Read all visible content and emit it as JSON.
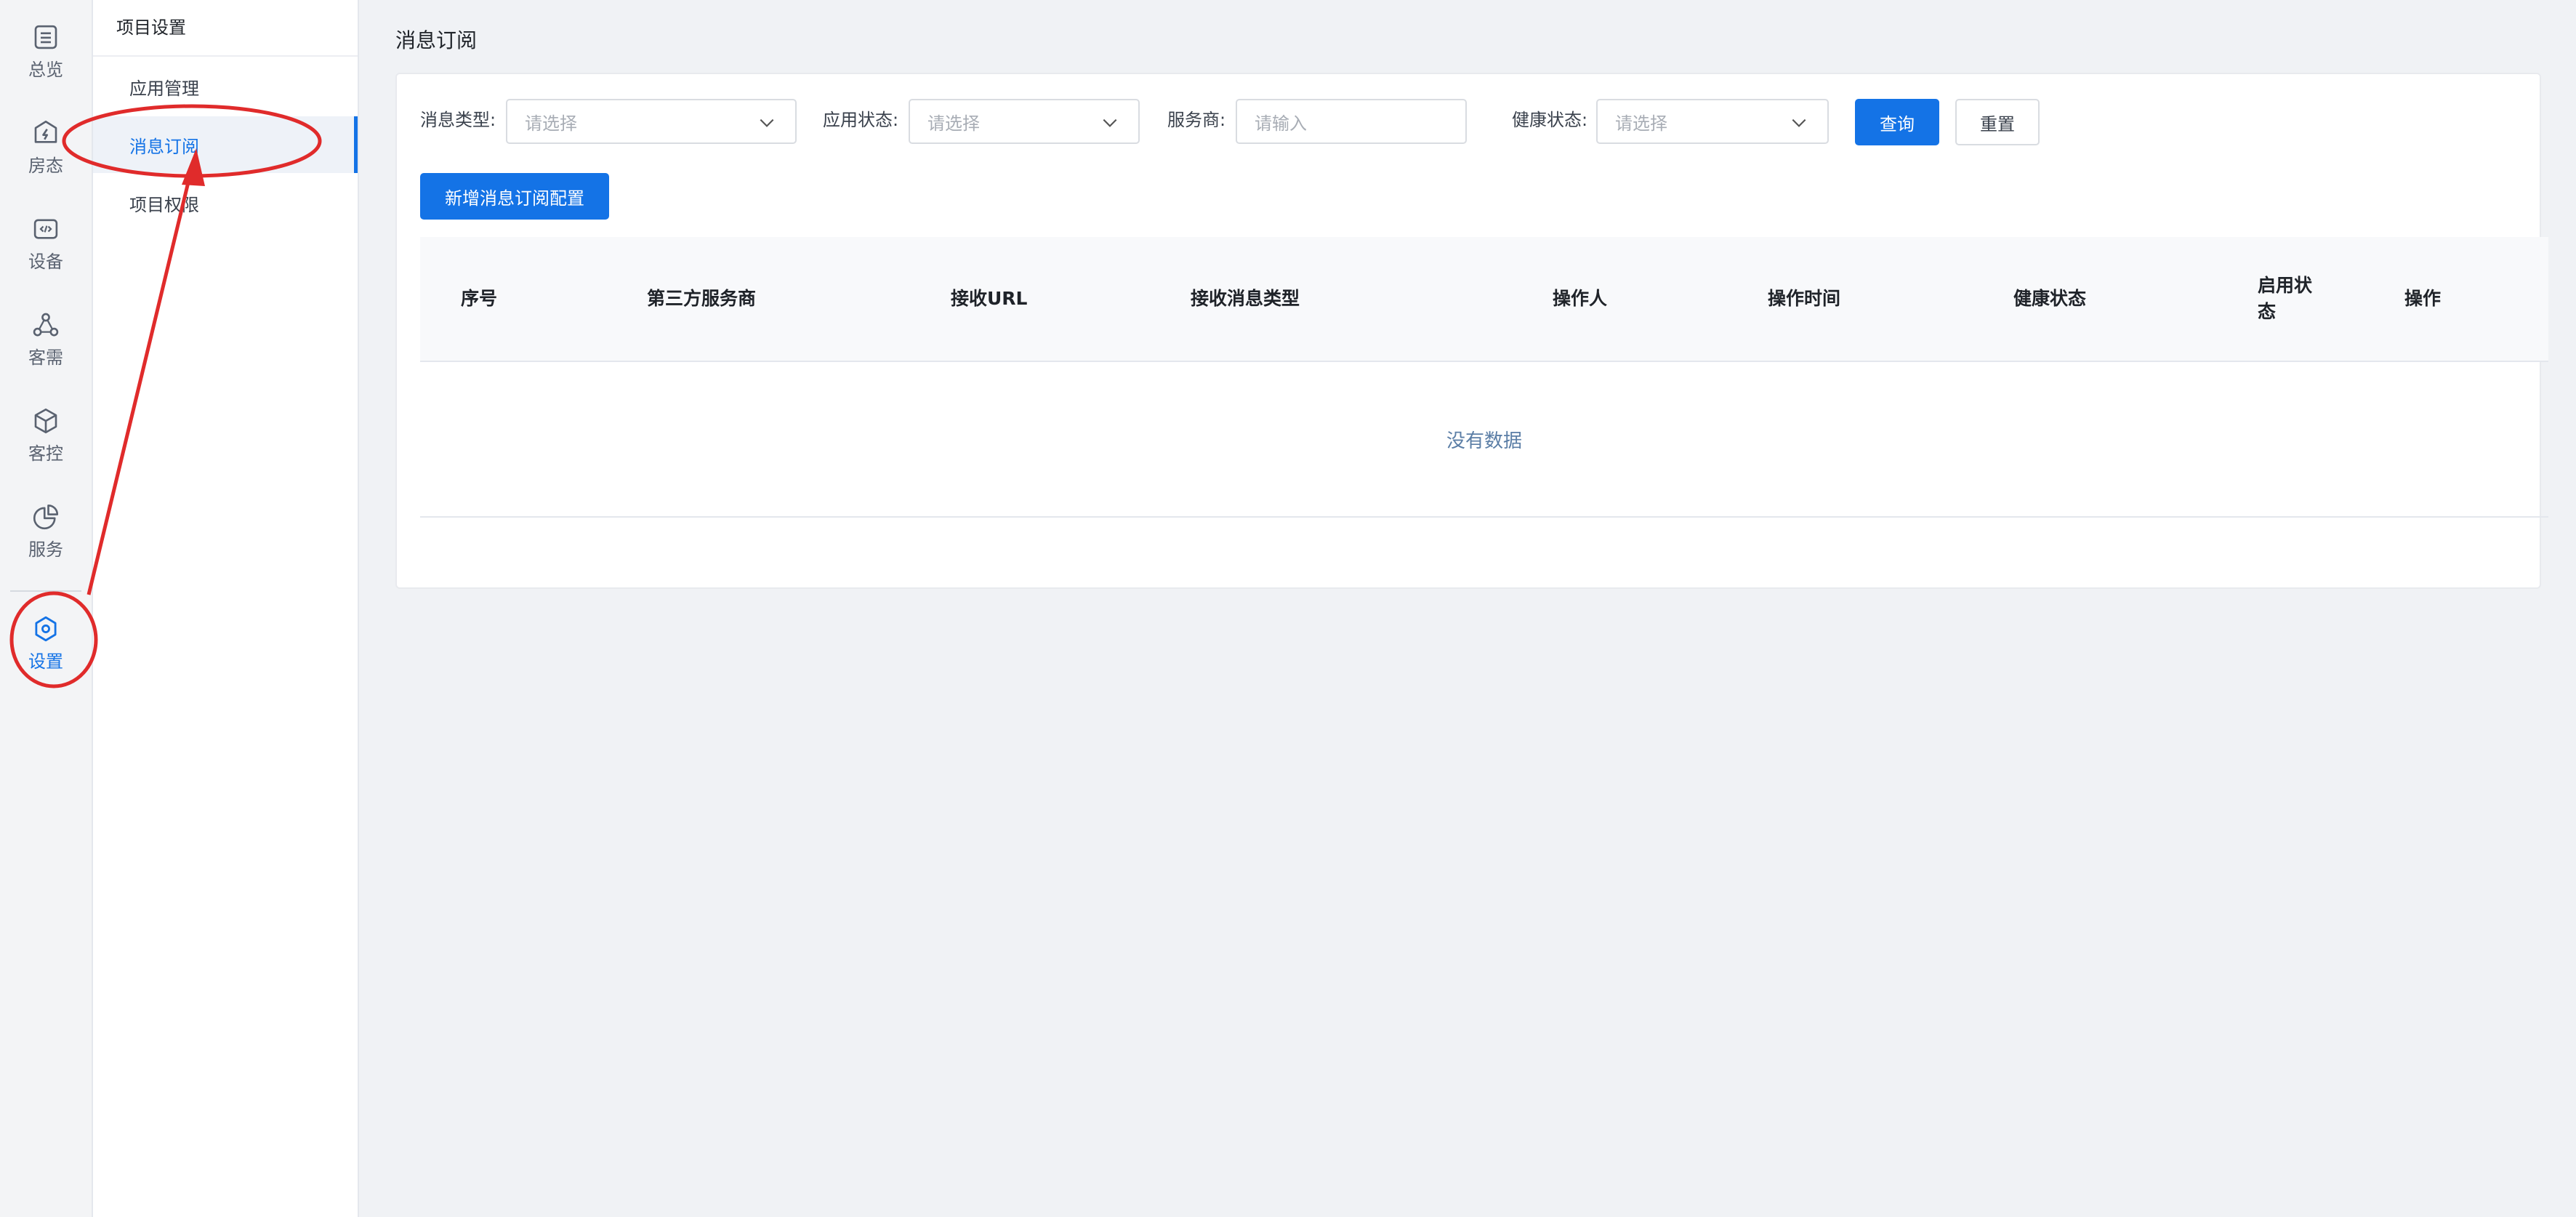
{
  "rail": {
    "items": [
      {
        "label": "总览",
        "icon": "list-icon"
      },
      {
        "label": "房态",
        "icon": "bolt-icon"
      },
      {
        "label": "设备",
        "icon": "code-icon"
      },
      {
        "label": "客需",
        "icon": "nodes-icon"
      },
      {
        "label": "客控",
        "icon": "cube-icon"
      },
      {
        "label": "服务",
        "icon": "pie-chart-icon"
      },
      {
        "label": "设置",
        "icon": "hexagon-settings-icon",
        "active": true
      }
    ]
  },
  "submenu": {
    "title": "项目设置",
    "items": [
      {
        "label": "应用管理"
      },
      {
        "label": "消息订阅",
        "active": true
      },
      {
        "label": "项目权限"
      }
    ]
  },
  "page": {
    "title": "消息订阅"
  },
  "filters": {
    "message_type": {
      "label": "消息类型:",
      "placeholder": "请选择"
    },
    "app_status": {
      "label": "应用状态:",
      "placeholder": "请选择"
    },
    "provider": {
      "label": "服务商:",
      "placeholder": "请输入"
    },
    "health_status": {
      "label": "健康状态:",
      "placeholder": "请选择"
    },
    "query_label": "查询",
    "reset_label": "重置"
  },
  "actions": {
    "add_label": "新增消息订阅配置"
  },
  "table": {
    "columns": [
      "序号",
      "第三方服务商",
      "接收URL",
      "接收消息类型",
      "操作人",
      "操作时间",
      "健康状态",
      "启用状",
      "操作"
    ],
    "status_col_wrap": "态",
    "empty_text": "没有数据",
    "rows": []
  },
  "colors": {
    "accent": "#1473e6",
    "annotation": "#e02b2b"
  }
}
